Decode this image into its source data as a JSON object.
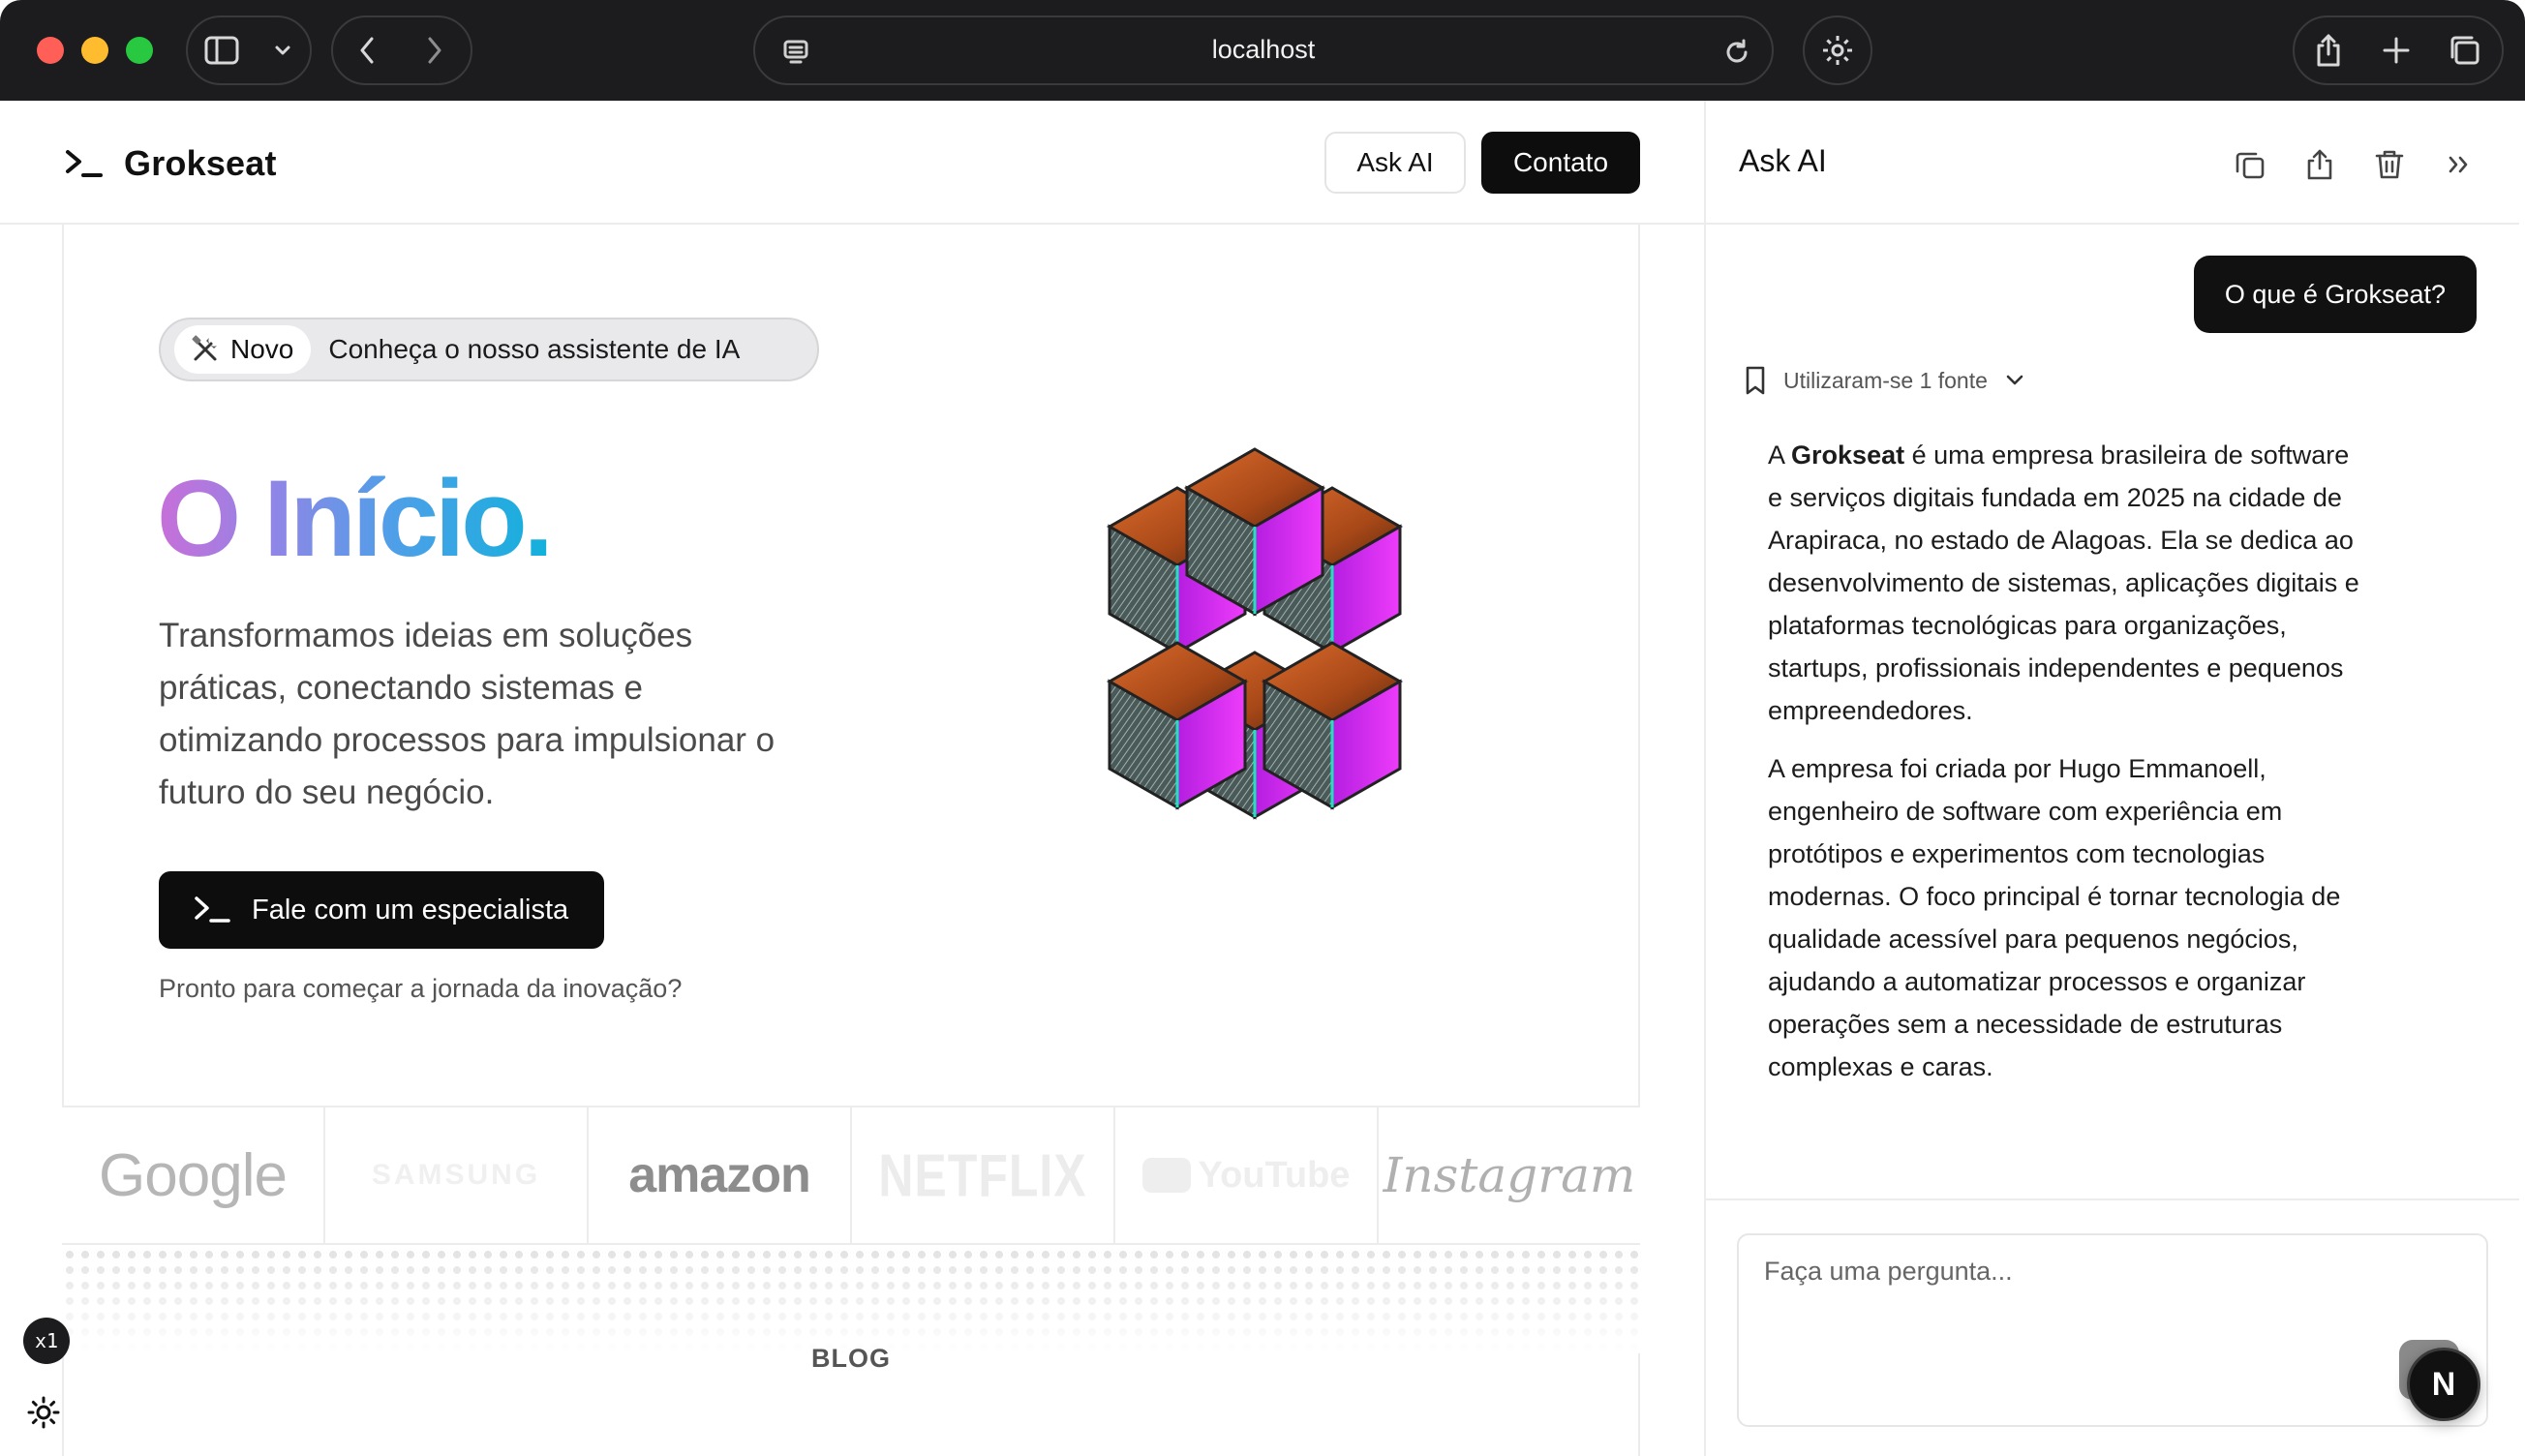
{
  "browser": {
    "url": "localhost"
  },
  "header": {
    "logo_text": "Grokseat",
    "ask_ai_label": "Ask AI",
    "contact_label": "Contato"
  },
  "hero": {
    "badge_label": "Novo",
    "badge_text": "Conheça o nosso assistente de IA",
    "title": "O Início.",
    "subtitle": "Transformamos ideias em soluções práticas, conectando sistemas e otimizando processos para impulsionar o futuro do seu negócio.",
    "cta_label": "Fale com um especialista",
    "note": "Pronto para começar a jornada da inovação?"
  },
  "brands": [
    {
      "name": "Google"
    },
    {
      "name": "SAMSUNG"
    },
    {
      "name": "amazon"
    },
    {
      "name": "NETFLIX"
    },
    {
      "name": "YouTube"
    },
    {
      "name": "Instagram"
    }
  ],
  "section_label": "BLOG",
  "dev_overlay": {
    "zoom_badge": "x1",
    "framework_badge": "N"
  },
  "ask_ai_panel": {
    "title": "Ask AI",
    "user_question": "O que é Grokseat?",
    "sources_label": "Utilizaram-se 1 fonte",
    "answer_p1_brand": "Grokseat",
    "answer_p1_prefix": "A ",
    "answer_p1_rest": " é uma empresa brasileira de software e serviços digitais fundada em 2025 na cidade de Arapiraca, no estado de Alagoas. Ela se dedica ao desenvolvimento de sistemas, aplicações digitais e plataformas tecnológicas para organizações, startups, profissionais independentes e pequenos empreendedores.",
    "answer_p2": "A empresa foi criada por Hugo Emmanoell, engenheiro de software com experiência em protótipos e experimentos com tecnologias modernas. O foco principal é tornar tecnologia de qualidade acessível para pequenos negócios, ajudando a automatizar processos e organizar operações sem a necessidade de estruturas complexas e caras.",
    "input_placeholder": "Faça uma pergunta..."
  },
  "colors": {
    "title_gradient": [
      "#c86fd9",
      "#8f86e6",
      "#4f9fe8",
      "#12b1dc"
    ],
    "cube_top": "#b5561e",
    "cube_side_magenta": "#d22bf0",
    "chrome_bg": "#1c1c1e"
  }
}
